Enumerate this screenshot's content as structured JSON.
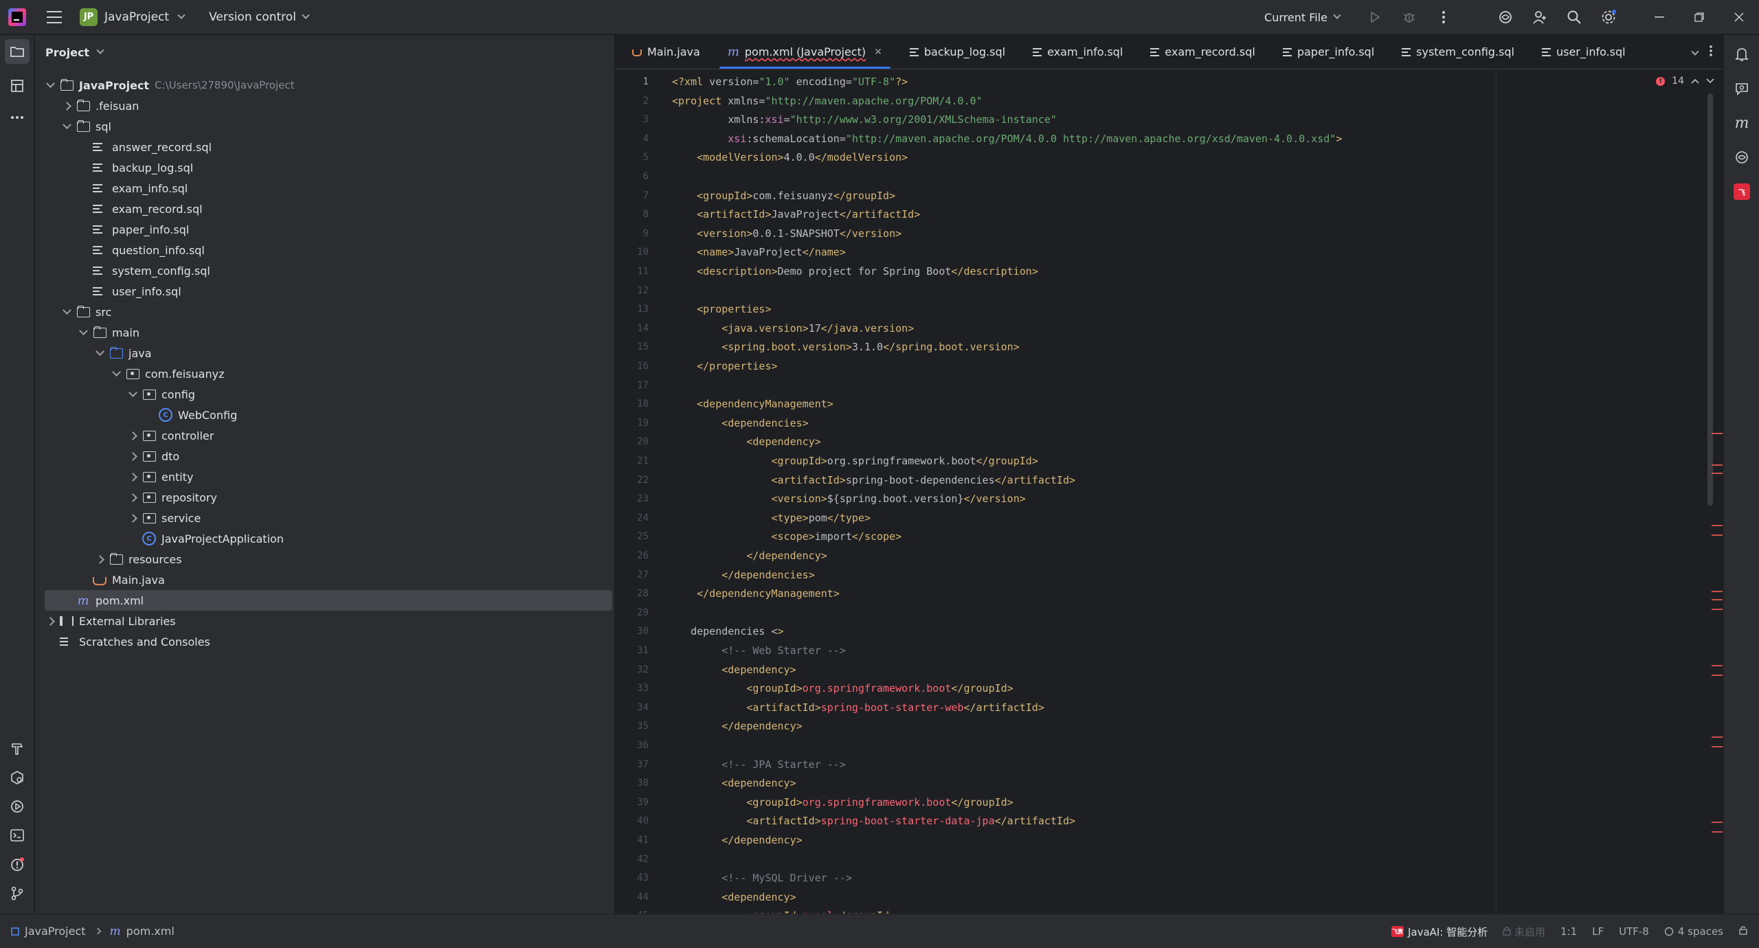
{
  "titlebar": {
    "project_badge": "JP",
    "project_name": "JavaProject",
    "version_control": "Version control",
    "run_config": "Current File"
  },
  "project_panel": {
    "title": "Project",
    "root_name": "JavaProject",
    "root_path": "C:\\Users\\27890\\JavaProject",
    "nodes": {
      "feisuan": ".feisuan",
      "sql": "sql",
      "answer_record": "answer_record.sql",
      "backup_log": "backup_log.sql",
      "exam_info": "exam_info.sql",
      "exam_record": "exam_record.sql",
      "paper_info": "paper_info.sql",
      "question_info": "question_info.sql",
      "system_config": "system_config.sql",
      "user_info": "user_info.sql",
      "src": "src",
      "main": "main",
      "java": "java",
      "pkg": "com.feisuanyz",
      "config": "config",
      "webconfig": "WebConfig",
      "controller": "controller",
      "dto": "dto",
      "entity": "entity",
      "repository": "repository",
      "service": "service",
      "app": "JavaProjectApplication",
      "resources": "resources",
      "main_java": "Main.java",
      "pom": "pom.xml",
      "ext_libs": "External Libraries",
      "scratches": "Scratches and Consoles"
    }
  },
  "tabs": [
    {
      "label": "Main.java"
    },
    {
      "label": "pom.xml (JavaProject)"
    },
    {
      "label": "backup_log.sql"
    },
    {
      "label": "exam_info.sql"
    },
    {
      "label": "exam_record.sql"
    },
    {
      "label": "paper_info.sql"
    },
    {
      "label": "system_config.sql"
    },
    {
      "label": "user_info.sql"
    }
  ],
  "editor": {
    "error_count": "14",
    "lines": [
      "<?xml version=\"1.0\" encoding=\"UTF-8\"?>",
      "<project xmlns=\"http://maven.apache.org/POM/4.0.0\"",
      "         xmlns:xsi=\"http://www.w3.org/2001/XMLSchema-instance\"",
      "         xsi:schemaLocation=\"http://maven.apache.org/POM/4.0.0 http://maven.apache.org/xsd/maven-4.0.0.xsd\">",
      "    <modelVersion>4.0.0</modelVersion>",
      "",
      "    <groupId>com.feisuanyz</groupId>",
      "    <artifactId>JavaProject</artifactId>",
      "    <version>0.0.1-SNAPSHOT</version>",
      "    <name>JavaProject</name>",
      "    <description>Demo project for Spring Boot</description>",
      "",
      "    <properties>",
      "        <java.version>17</java.version>",
      "        <spring.boot.version>3.1.0</spring.boot.version>",
      "    </properties>",
      "",
      "    <dependencyManagement>",
      "        <dependencies>",
      "            <dependency>",
      "                <groupId>org.springframework.boot</groupId>",
      "                <artifactId>spring-boot-dependencies</artifactId>",
      "                <version>${spring.boot.version}</version>",
      "                <type>pom</type>",
      "                <scope>import</scope>",
      "            </dependency>",
      "        </dependencies>",
      "    </dependencyManagement>",
      "",
      "   dependencies <>",
      "        <!-- Web Starter -->",
      "        <dependency>",
      "            <groupId>org.springframework.boot</groupId>",
      "            <artifactId>spring-boot-starter-web</artifactId>",
      "        </dependency>",
      "",
      "        <!-- JPA Starter -->",
      "        <dependency>",
      "            <groupId>org.springframework.boot</groupId>",
      "            <artifactId>spring-boot-starter-data-jpa</artifactId>",
      "        </dependency>",
      "",
      "        <!-- MySQL Driver -->",
      "        <dependency>",
      "            <groupId>mysql</groupId>"
    ]
  },
  "statusbar": {
    "crumb_project": "JavaProject",
    "crumb_file": "pom.xml",
    "javaai_label": "JavaAI: 智能分析",
    "javaai_logo": "飞算",
    "disabled_label": "未启用",
    "position": "1:1",
    "line_sep": "LF",
    "encoding": "UTF-8",
    "indent": "4 spaces"
  },
  "colors": {
    "accent": "#3574f0",
    "error": "#f75464",
    "tag": "#d5b778",
    "string": "#6aab73"
  }
}
